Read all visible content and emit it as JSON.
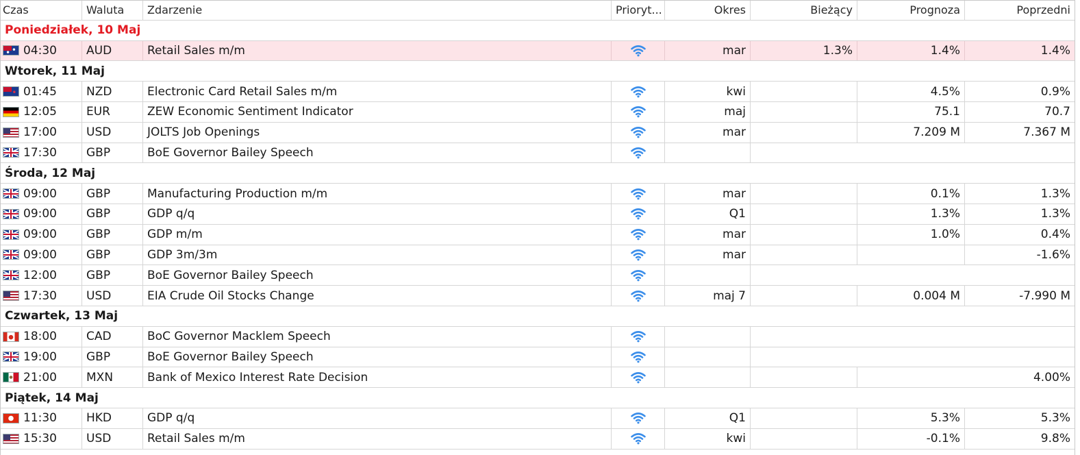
{
  "columns": {
    "time": "Czas",
    "currency": "Waluta",
    "event": "Zdarzenie",
    "priority": "Prioryt...",
    "period": "Okres",
    "actual": "Bieżący",
    "forecast": "Prognoza",
    "previous": "Poprzedni"
  },
  "colors": {
    "today": "#e31b23",
    "highlight": "#fde4e8",
    "priority_icon": "#3b8eea"
  },
  "days": [
    {
      "label": "Poniedziałek, 10 Maj",
      "today": true,
      "events": [
        {
          "flag": "au",
          "time": "04:30",
          "currency": "AUD",
          "event": "Retail Sales m/m",
          "priority_icon": "wifi-signal-icon",
          "period": "mar",
          "actual": "1.3%",
          "forecast": "1.4%",
          "previous": "1.4%",
          "highlight": true,
          "empty_fc": false,
          "speech": false
        }
      ]
    },
    {
      "label": "Wtorek, 11 Maj",
      "today": false,
      "events": [
        {
          "flag": "nz",
          "time": "01:45",
          "currency": "NZD",
          "event": "Electronic Card Retail Sales m/m",
          "priority_icon": "wifi-signal-icon",
          "period": "kwi",
          "actual": "",
          "forecast": "4.5%",
          "previous": "0.9%",
          "highlight": false,
          "empty_fc": false,
          "speech": false
        },
        {
          "flag": "de",
          "time": "12:05",
          "currency": "EUR",
          "event": "ZEW Economic Sentiment Indicator",
          "priority_icon": "wifi-signal-icon",
          "period": "maj",
          "actual": "",
          "forecast": "75.1",
          "previous": "70.7",
          "highlight": false,
          "empty_fc": false,
          "speech": false
        },
        {
          "flag": "us",
          "time": "17:00",
          "currency": "USD",
          "event": "JOLTS Job Openings",
          "priority_icon": "wifi-signal-icon",
          "period": "mar",
          "actual": "",
          "forecast": "7.209 M",
          "previous": "7.367 M",
          "highlight": false,
          "empty_fc": false,
          "speech": false
        },
        {
          "flag": "gb",
          "time": "17:30",
          "currency": "GBP",
          "event": "BoE Governor Bailey Speech",
          "priority_icon": "wifi-signal-icon",
          "period": "",
          "actual": "",
          "forecast": "",
          "previous": "",
          "highlight": false,
          "empty_fc": false,
          "speech": true
        }
      ]
    },
    {
      "label": "Środa, 12 Maj",
      "today": false,
      "events": [
        {
          "flag": "gb",
          "time": "09:00",
          "currency": "GBP",
          "event": "Manufacturing Production m/m",
          "priority_icon": "wifi-signal-icon",
          "period": "mar",
          "actual": "",
          "forecast": "0.1%",
          "previous": "1.3%",
          "highlight": false,
          "empty_fc": false,
          "speech": false
        },
        {
          "flag": "gb",
          "time": "09:00",
          "currency": "GBP",
          "event": "GDP q/q",
          "priority_icon": "wifi-signal-icon",
          "period": "Q1",
          "actual": "",
          "forecast": "1.3%",
          "previous": "1.3%",
          "highlight": false,
          "empty_fc": false,
          "speech": false
        },
        {
          "flag": "gb",
          "time": "09:00",
          "currency": "GBP",
          "event": "GDP m/m",
          "priority_icon": "wifi-signal-icon",
          "period": "mar",
          "actual": "",
          "forecast": "1.0%",
          "previous": "0.4%",
          "highlight": false,
          "empty_fc": false,
          "speech": false
        },
        {
          "flag": "gb",
          "time": "09:00",
          "currency": "GBP",
          "event": "GDP 3m/3m",
          "priority_icon": "wifi-signal-icon",
          "period": "mar",
          "actual": "",
          "forecast": "",
          "previous": "-1.6%",
          "highlight": false,
          "empty_fc": false,
          "speech": false
        },
        {
          "flag": "gb",
          "time": "12:00",
          "currency": "GBP",
          "event": "BoE Governor Bailey Speech",
          "priority_icon": "wifi-signal-icon",
          "period": "",
          "actual": "",
          "forecast": "",
          "previous": "",
          "highlight": false,
          "empty_fc": false,
          "speech": true
        },
        {
          "flag": "us",
          "time": "17:30",
          "currency": "USD",
          "event": "EIA Crude Oil Stocks Change",
          "priority_icon": "wifi-signal-icon",
          "period": "maj 7",
          "actual": "",
          "forecast": "0.004 M",
          "previous": "-7.990 M",
          "highlight": false,
          "empty_fc": false,
          "speech": false
        }
      ]
    },
    {
      "label": "Czwartek, 13 Maj",
      "today": false,
      "events": [
        {
          "flag": "ca",
          "time": "18:00",
          "currency": "CAD",
          "event": "BoC Governor Macklem Speech",
          "priority_icon": "wifi-signal-icon",
          "period": "",
          "actual": "",
          "forecast": "",
          "previous": "",
          "highlight": false,
          "empty_fc": false,
          "speech": true
        },
        {
          "flag": "gb",
          "time": "19:00",
          "currency": "GBP",
          "event": "BoE Governor Bailey Speech",
          "priority_icon": "wifi-signal-icon",
          "period": "",
          "actual": "",
          "forecast": "",
          "previous": "",
          "highlight": false,
          "empty_fc": false,
          "speech": true
        },
        {
          "flag": "mx",
          "time": "21:00",
          "currency": "MXN",
          "event": "Bank of Mexico Interest Rate Decision",
          "priority_icon": "wifi-signal-icon",
          "period": "",
          "actual": "",
          "forecast": "",
          "previous": "4.00%",
          "highlight": false,
          "empty_fc": true,
          "speech": false
        }
      ]
    },
    {
      "label": "Piątek, 14 Maj",
      "today": false,
      "events": [
        {
          "flag": "hk",
          "time": "11:30",
          "currency": "HKD",
          "event": "GDP q/q",
          "priority_icon": "wifi-signal-icon",
          "period": "Q1",
          "actual": "",
          "forecast": "5.3%",
          "previous": "5.3%",
          "highlight": false,
          "empty_fc": false,
          "speech": false
        },
        {
          "flag": "us",
          "time": "15:30",
          "currency": "USD",
          "event": "Retail Sales m/m",
          "priority_icon": "wifi-signal-icon",
          "period": "kwi",
          "actual": "",
          "forecast": "-0.1%",
          "previous": "9.8%",
          "highlight": false,
          "empty_fc": false,
          "speech": false
        }
      ]
    }
  ]
}
